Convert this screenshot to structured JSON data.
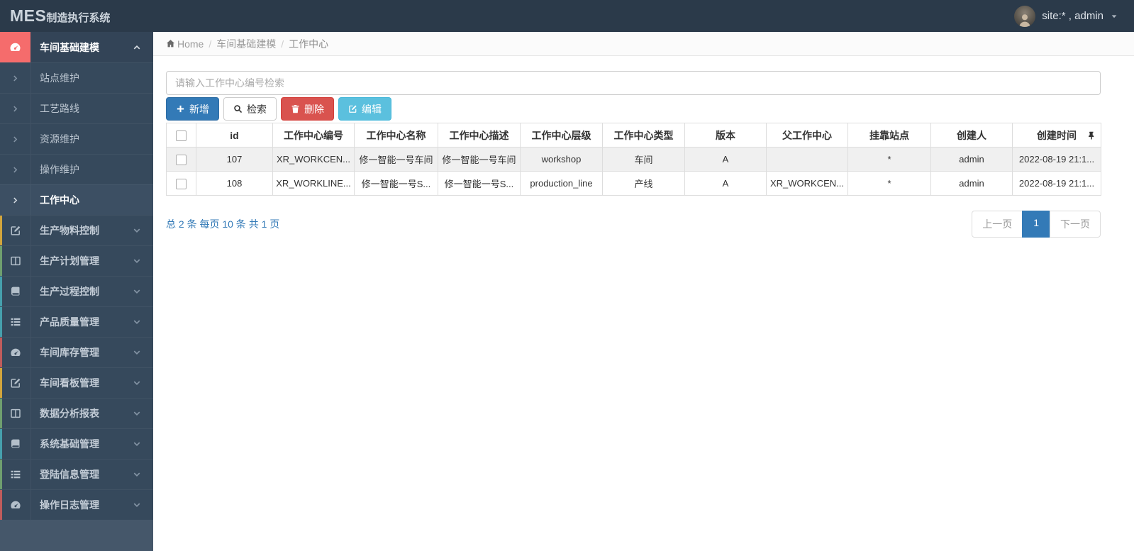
{
  "topbar": {
    "logo_mes": "MES",
    "logo_rest": "制造执行系统",
    "user_label": "site:* , admin"
  },
  "breadcrumb": {
    "home": "Home",
    "section": "车间基础建模",
    "current": "工作中心"
  },
  "sidebar": {
    "active_group": {
      "label": "车间基础建模",
      "icon": "dashboard-icon"
    },
    "submenu": [
      {
        "label": "站点维护",
        "active": false
      },
      {
        "label": "工艺路线",
        "active": false
      },
      {
        "label": "资源维护",
        "active": false
      },
      {
        "label": "操作维护",
        "active": false
      },
      {
        "label": "工作中心",
        "active": true
      }
    ],
    "groups": [
      {
        "label": "生产物料控制",
        "icon": "edit-icon",
        "strip": "#d3a53c"
      },
      {
        "label": "生产计划管理",
        "icon": "columns-icon",
        "strip": "#6f9f6f"
      },
      {
        "label": "生产过程控制",
        "icon": "book-icon",
        "strip": "#46a0ad"
      },
      {
        "label": "产品质量管理",
        "icon": "list-icon",
        "strip": "#46a0ad"
      },
      {
        "label": "车间库存管理",
        "icon": "dashboard-icon",
        "strip": "#c05c5c"
      },
      {
        "label": "车间看板管理",
        "icon": "edit-icon",
        "strip": "#d3a53c"
      },
      {
        "label": "数据分析报表",
        "icon": "columns-icon",
        "strip": "#6f9f6f"
      },
      {
        "label": "系统基础管理",
        "icon": "book-icon",
        "strip": "#46a0ad"
      },
      {
        "label": "登陆信息管理",
        "icon": "list-icon",
        "strip": "#6f9f6f"
      },
      {
        "label": "操作日志管理",
        "icon": "dashboard-icon",
        "strip": "#c05c5c"
      }
    ]
  },
  "search": {
    "placeholder": "请输入工作中心编号检索",
    "value": ""
  },
  "toolbar": {
    "add_label": "新增",
    "search_label": "检索",
    "delete_label": "删除",
    "edit_label": "编辑"
  },
  "table": {
    "columns": [
      "id",
      "工作中心编号",
      "工作中心名称",
      "工作中心描述",
      "工作中心层级",
      "工作中心类型",
      "版本",
      "父工作中心",
      "挂靠站点",
      "创建人",
      "创建时间"
    ],
    "rows": [
      {
        "checked": false,
        "cells": [
          "107",
          "XR_WORKCEN...",
          "修一智能一号车间",
          "修一智能一号车间",
          "workshop",
          "车间",
          "A",
          "",
          "*",
          "admin",
          "2022-08-19 21:1..."
        ]
      },
      {
        "checked": false,
        "cells": [
          "108",
          "XR_WORKLINE...",
          "修一智能一号S...",
          "修一智能一号S...",
          "production_line",
          "产线",
          "A",
          "XR_WORKCEN...",
          "*",
          "admin",
          "2022-08-19 21:1..."
        ]
      }
    ]
  },
  "pagination": {
    "summary": "总 2 条 每页 10 条 共 1 页",
    "prev": "上一页",
    "current": "1",
    "next": "下一页"
  },
  "colors": {
    "topbar_bg": "#2b3a4a",
    "sidebar_bg": "#45576a",
    "menu_item_bg": "#36495c",
    "active_icon_block": "#f56c6c",
    "primary": "#337ab7",
    "danger": "#d9534f",
    "info": "#5bc0de",
    "pagination_active": "#337ab7"
  }
}
